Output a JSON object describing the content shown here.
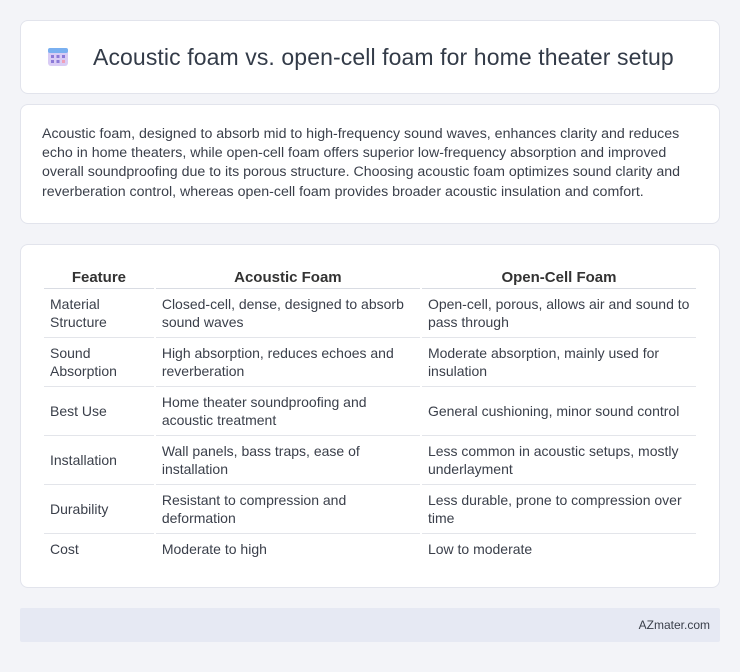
{
  "header": {
    "title": "Acoustic foam vs. open-cell foam for home theater setup",
    "icon": "calendar-grid-icon"
  },
  "summary": {
    "text": "Acoustic foam, designed to absorb mid to high-frequency sound waves, enhances clarity and reduces echo in home theaters, while open-cell foam offers superior low-frequency absorption and improved overall soundproofing due to its porous structure. Choosing acoustic foam optimizes sound clarity and reverberation control, whereas open-cell foam provides broader acoustic insulation and comfort."
  },
  "table": {
    "headers": [
      "Feature",
      "Acoustic Foam",
      "Open-Cell Foam"
    ],
    "rows": [
      [
        "Material Structure",
        "Closed-cell, dense, designed to absorb sound waves",
        "Open-cell, porous, allows air and sound to pass through"
      ],
      [
        "Sound Absorption",
        "High absorption, reduces echoes and reverberation",
        "Moderate absorption, mainly used for insulation"
      ],
      [
        "Best Use",
        "Home theater soundproofing and acoustic treatment",
        "General cushioning, minor sound control"
      ],
      [
        "Installation",
        "Wall panels, bass traps, ease of installation",
        "Less common in acoustic setups, mostly underlayment"
      ],
      [
        "Durability",
        "Resistant to compression and deformation",
        "Less durable, prone to compression over time"
      ],
      [
        "Cost",
        "Moderate to high",
        "Low to moderate"
      ]
    ]
  },
  "footer": {
    "brand": "AZmater.com"
  }
}
